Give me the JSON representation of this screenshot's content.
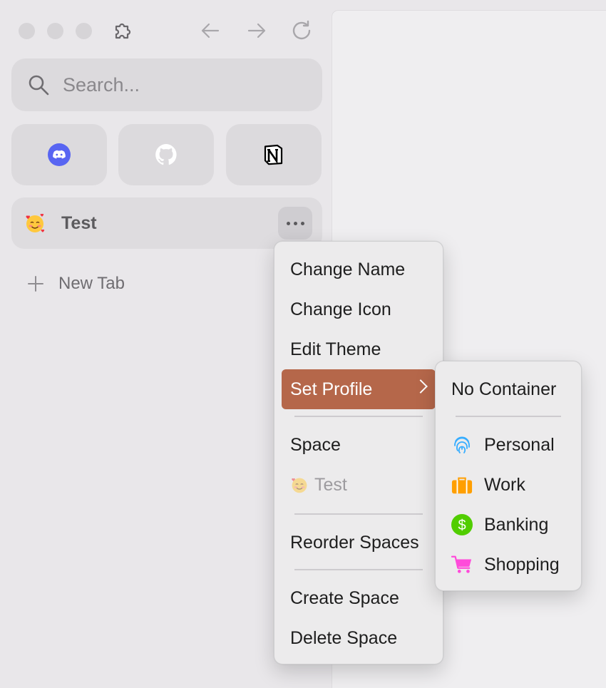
{
  "toolbar": {
    "extensions_icon": "puzzle-icon",
    "back_icon": "arrow-left-icon",
    "forward_icon": "arrow-right-icon",
    "reload_icon": "reload-icon"
  },
  "search": {
    "placeholder": "Search..."
  },
  "pinned": [
    {
      "name": "Discord",
      "icon": "discord-icon",
      "color": "#5865F2"
    },
    {
      "name": "GitHub",
      "icon": "github-icon",
      "color": "#ffffff"
    },
    {
      "name": "Notion",
      "icon": "notion-icon",
      "color": "#000000"
    }
  ],
  "space": {
    "emoji": "smiling-face-with-hearts",
    "name": "Test"
  },
  "new_tab": {
    "label": "New Tab"
  },
  "context_menu": {
    "items": [
      {
        "label": "Change Name"
      },
      {
        "label": "Change Icon"
      },
      {
        "label": "Edit Theme"
      },
      {
        "label": "Set Profile",
        "active": true,
        "submenu": true
      },
      {
        "label": "Space",
        "section": true
      },
      {
        "label": "Test",
        "disabled": true
      },
      {
        "label": "Reorder Spaces"
      },
      {
        "label": "Create Space"
      },
      {
        "label": "Delete Space"
      }
    ],
    "accent": "#b5674a"
  },
  "profile_menu": {
    "no_container": "No Container",
    "profiles": [
      {
        "label": "Personal",
        "icon": "fingerprint-icon",
        "color": "#37adff"
      },
      {
        "label": "Work",
        "icon": "briefcase-icon",
        "color": "#ff9f00"
      },
      {
        "label": "Banking",
        "icon": "dollar-icon",
        "color": "#51cd00"
      },
      {
        "label": "Shopping",
        "icon": "cart-icon",
        "color": "#ff4bda"
      }
    ]
  }
}
